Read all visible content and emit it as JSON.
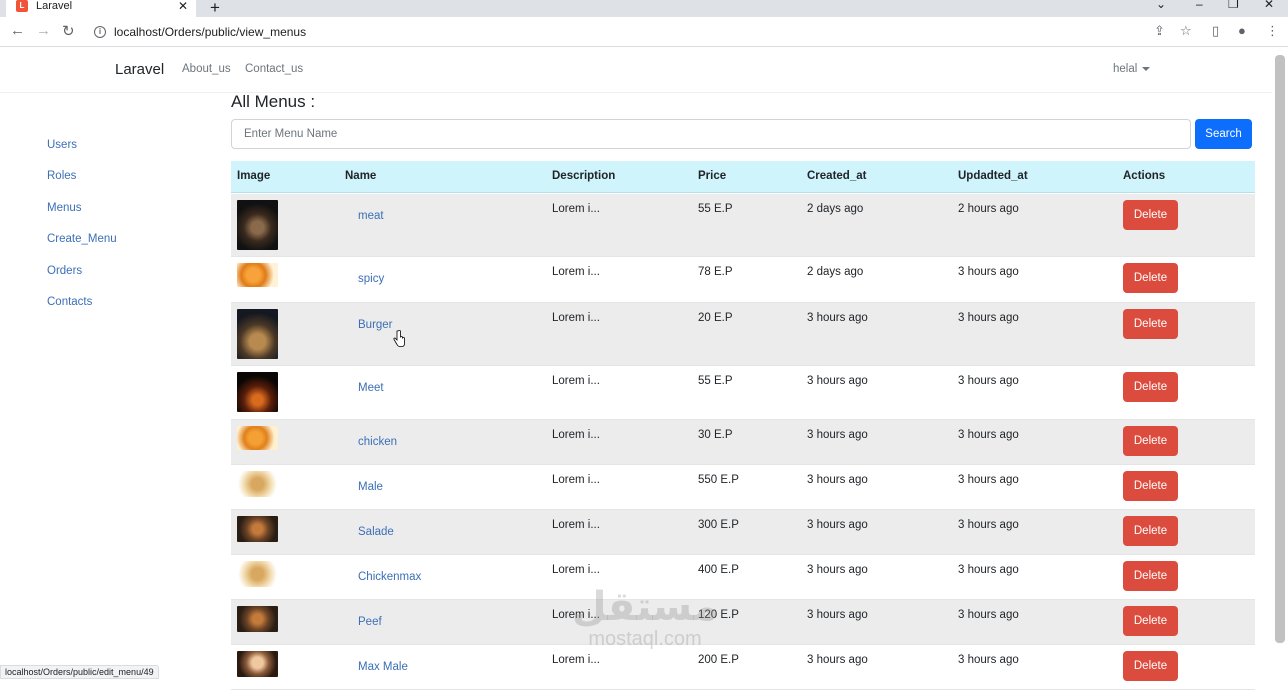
{
  "browser": {
    "tab_title": "Laravel",
    "tab_close": "✕",
    "new_tab": "+",
    "url": "localhost/Orders/public/view_menus",
    "status_url": "localhost/Orders/public/edit_menu/49"
  },
  "navbar": {
    "brand": "Laravel",
    "links": [
      "About_us",
      "Contact_us"
    ],
    "user": "helal"
  },
  "sidebar": {
    "items": [
      "Users",
      "Roles",
      "Menus",
      "Create_Menu",
      "Orders",
      "Contacts"
    ]
  },
  "main": {
    "title": "All Menus :",
    "search": {
      "placeholder": "Enter Menu Name",
      "button": "Search"
    },
    "columns": [
      "Image",
      "Name",
      "Description",
      "Price",
      "Created_at",
      "Updadted_at",
      "Actions"
    ],
    "delete_label": "Delete",
    "rows": [
      {
        "image": "meat-photo",
        "name": "meat",
        "description": "Lorem i...",
        "price": "55 E.P",
        "created": "2 days ago",
        "updated": "2 hours ago"
      },
      {
        "image": "spicy-photo",
        "name": "spicy",
        "description": "Lorem i...",
        "price": "78 E.P",
        "created": "2 days ago",
        "updated": "3 hours ago"
      },
      {
        "image": "burger-photo",
        "name": "Burger",
        "description": "Lorem i...",
        "price": "20 E.P",
        "created": "3 hours ago",
        "updated": "3 hours ago"
      },
      {
        "image": "meet-photo",
        "name": "Meet",
        "description": "Lorem i...",
        "price": "55 E.P",
        "created": "3 hours ago",
        "updated": "3 hours ago"
      },
      {
        "image": "chicken-photo",
        "name": "chicken",
        "description": "Lorem i...",
        "price": "30 E.P",
        "created": "3 hours ago",
        "updated": "3 hours ago"
      },
      {
        "image": "male-photo",
        "name": "Male",
        "description": "Lorem i...",
        "price": "550 E.P",
        "created": "3 hours ago",
        "updated": "3 hours ago"
      },
      {
        "image": "salade-photo",
        "name": "Salade",
        "description": "Lorem i...",
        "price": "300 E.P",
        "created": "3 hours ago",
        "updated": "3 hours ago"
      },
      {
        "image": "chickenmax-photo",
        "name": "Chickenmax",
        "description": "Lorem i...",
        "price": "400 E.P",
        "created": "3 hours ago",
        "updated": "3 hours ago"
      },
      {
        "image": "peef-photo",
        "name": "Peef",
        "description": "Lorem i...",
        "price": "120 E.P",
        "created": "3 hours ago",
        "updated": "3 hours ago"
      },
      {
        "image": "max-male-photo",
        "name": "Max Male",
        "description": "Lorem i...",
        "price": "200 E.P",
        "created": "3 hours ago",
        "updated": "3 hours ago"
      }
    ]
  },
  "watermark": {
    "arabic": "مستقل",
    "latin": "mostaql.com"
  },
  "colors": {
    "primary": "#0d6efd",
    "danger": "#dc4c3e",
    "table_head": "#cff4fc",
    "link": "#3b6fb6"
  }
}
